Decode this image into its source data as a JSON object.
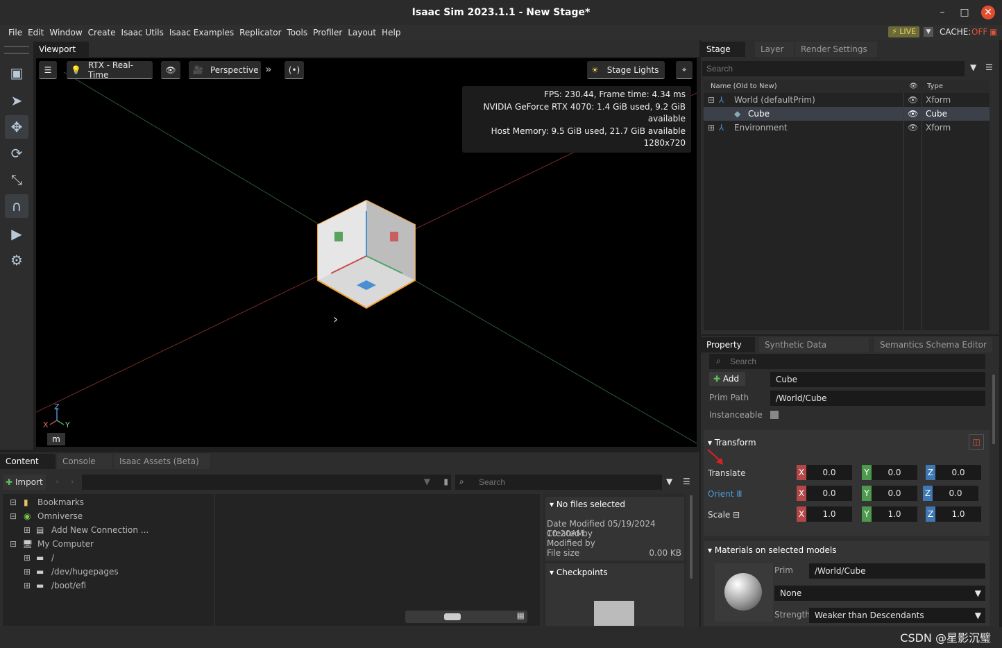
{
  "window": {
    "title": "Isaac Sim 2023.1.1 - New Stage*",
    "minimize": "–",
    "maximize": "□",
    "close": "✕"
  },
  "menu": {
    "items": [
      "File",
      "Edit",
      "Window",
      "Create",
      "Isaac Utils",
      "Isaac Examples",
      "Replicator",
      "Tools",
      "Profiler",
      "Layout",
      "Help"
    ],
    "live": "LIVE",
    "cache_label": "CACHE:",
    "cache_state": "OFF"
  },
  "left_toolbar": {
    "tools": [
      "box-select-icon",
      "select-arrow-icon",
      "move-icon",
      "rotate-icon",
      "scale-icon",
      "snap-magnet-icon",
      "play-icon",
      "robot-icon"
    ]
  },
  "viewport": {
    "tab": "Viewport",
    "renderer": "RTX - Real-Time",
    "camera": "Perspective",
    "lights": "Stage Lights",
    "stats": [
      "FPS: 230.44, Frame time: 4.34 ms",
      "NVIDIA GeForce RTX 4070: 1.4 GiB used, 9.2 GiB available",
      "Host Memory: 9.5 GiB used, 21.7 GiB available",
      "1280x720"
    ],
    "axis": {
      "z": "Z",
      "x": "X",
      "y": "Y"
    },
    "units": "m"
  },
  "stage": {
    "tabs": [
      "Stage",
      "Layer",
      "Render Settings"
    ],
    "search_placeholder": "Search",
    "col_name": "Name (Old to New)",
    "col_type": "Type",
    "rows": [
      {
        "name": "World (defaultPrim)",
        "type": "Xform"
      },
      {
        "name": "Cube",
        "type": "Cube"
      },
      {
        "name": "Environment",
        "type": "Xform"
      }
    ]
  },
  "property": {
    "tabs": [
      "Property",
      "Synthetic Data Recorder",
      "Semantics Schema Editor"
    ],
    "search_placeholder": "Search",
    "add_label": "Add",
    "prim_name": "Cube",
    "prim_path_label": "Prim Path",
    "prim_path": "/World/Cube",
    "instanceable_label": "Instanceable",
    "transform_label": "Transform",
    "translate_label": "Translate",
    "orient_label": "Orient",
    "scale_label": "Scale",
    "translate": [
      "0.0",
      "0.0",
      "0.0"
    ],
    "orient": [
      "0.0",
      "0.0",
      "0.0"
    ],
    "scale": [
      "1.0",
      "1.0",
      "1.0"
    ],
    "materials_label": "Materials on selected models",
    "prim_label": "Prim",
    "material_prim": "/World/Cube",
    "material": "None",
    "strength_label": "Strength",
    "strength": "Weaker than Descendants"
  },
  "content": {
    "tabs": [
      "Content",
      "Console",
      "Isaac Assets (Beta)"
    ],
    "import_label": "Import",
    "search_placeholder": "Search",
    "tree": [
      {
        "label": "Bookmarks",
        "level": 0
      },
      {
        "label": "Omniverse",
        "level": 0
      },
      {
        "label": "Add New Connection ...",
        "level": 1
      },
      {
        "label": "My Computer",
        "level": 0
      },
      {
        "label": "/",
        "level": 1
      },
      {
        "label": "/dev/hugepages",
        "level": 1
      },
      {
        "label": "/boot/efi",
        "level": 1
      }
    ],
    "details_title": "No files selected",
    "date_modified": "Date Modified 05/19/2024 10:20AM",
    "created_by": "Created by",
    "modified_by": "Modified by",
    "file_size_label": "File size",
    "file_size": "0.00 KB",
    "checkpoints": "Checkpoints"
  },
  "watermark": "CSDN @星影沉璧"
}
